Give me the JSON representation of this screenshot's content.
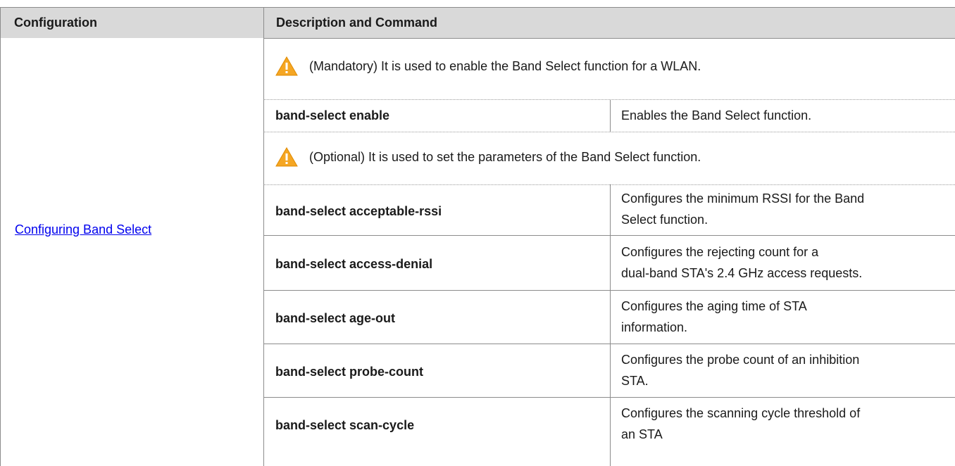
{
  "header": {
    "col1": "Configuration",
    "col2": "Description and Command"
  },
  "left_link": "Configuring Band Select",
  "notes": {
    "mandatory": "(Mandatory) It is used to enable the Band Select function for a WLAN.",
    "optional": "(Optional) It is used to set the parameters of the Band Select function."
  },
  "rows": [
    {
      "command": "band-select enable",
      "desc_line1": "Enables the Band Select function.",
      "desc_line2": ""
    },
    {
      "command": "band-select acceptable-rssi",
      "desc_line1": "Configures the minimum RSSI for the Band",
      "desc_line2": "Select function."
    },
    {
      "command": "band-select access-denial",
      "desc_line1": "Configures the rejecting count for a",
      "desc_line2": "dual-band STA's 2.4 GHz access requests."
    },
    {
      "command": "band-select age-out",
      "desc_line1": "Configures the aging time of STA",
      "desc_line2": "information."
    },
    {
      "command": "band-select probe-count",
      "desc_line1": "Configures the probe count of an inhibition",
      "desc_line2": "STA."
    },
    {
      "command": "band-select scan-cycle",
      "desc_line1": "Configures the scanning cycle threshold of",
      "desc_line2": "an STA"
    }
  ],
  "icons": {
    "warning": "warning-icon",
    "warning_color": "#f5a623"
  }
}
